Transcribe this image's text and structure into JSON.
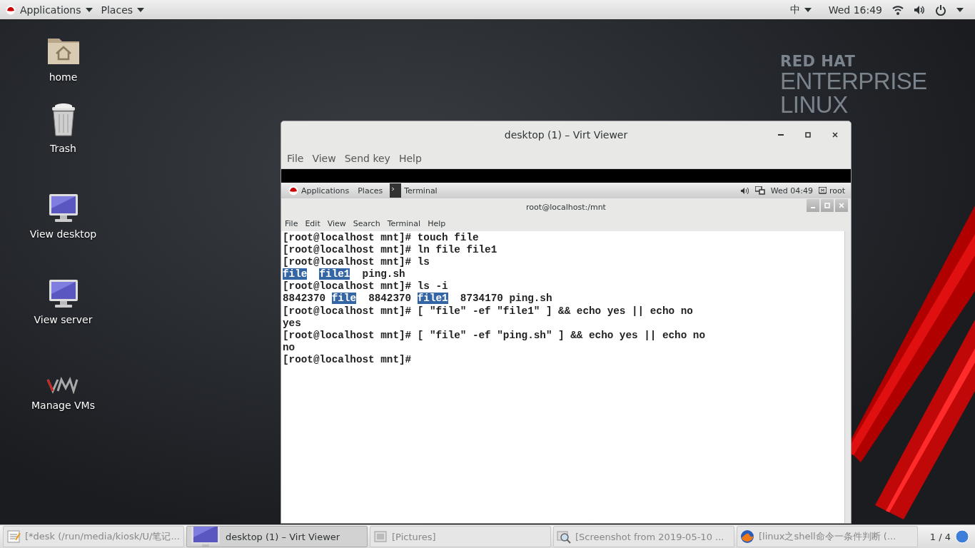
{
  "top_bar": {
    "menus": [
      "Applications",
      "Places"
    ],
    "input_method": "中",
    "clock": "Wed 16:49"
  },
  "desktop_icons": [
    {
      "label": "home",
      "kind": "home"
    },
    {
      "label": "Trash",
      "kind": "trash"
    },
    {
      "label": "View desktop",
      "kind": "monitor"
    },
    {
      "label": "View server",
      "kind": "monitor"
    },
    {
      "label": "Manage VMs",
      "kind": "vm"
    }
  ],
  "logo": {
    "brand": "RED HAT",
    "product": "ENTERPRISE",
    "suffix": "LINUX"
  },
  "window": {
    "title": "desktop (1) – Virt Viewer",
    "menu": [
      "File",
      "View",
      "Send key",
      "Help"
    ],
    "guest": {
      "top_bar": {
        "menus": [
          "Applications",
          "Places"
        ],
        "task": "Terminal",
        "clock": "Wed 04:49",
        "user": "root"
      },
      "terminal": {
        "title": "root@localhost:/mnt",
        "menu": [
          "File",
          "Edit",
          "View",
          "Search",
          "Terminal",
          "Help"
        ],
        "lines": [
          [
            {
              "text": "[root@localhost mnt]# touch file",
              "highlighted": false
            }
          ],
          [
            {
              "text": "[root@localhost mnt]# ln file file1",
              "highlighted": false
            }
          ],
          [
            {
              "text": "[root@localhost mnt]# ls",
              "highlighted": false
            }
          ],
          [
            {
              "text": "file",
              "highlighted": true
            },
            {
              "text": "file1",
              "highlighted": true
            },
            {
              "text": "  ping.sh",
              "highlighted": false
            }
          ],
          [
            {
              "text": "[root@localhost mnt]# ls -i",
              "highlighted": false
            }
          ],
          [
            {
              "text": "8842370",
              "highlighted": false
            },
            {
              "text": "file",
              "highlighted": true
            },
            {
              "text": "  8842370",
              "highlighted": false
            },
            {
              "text": "file1",
              "highlighted": true
            },
            {
              "text": "  8734170 ping.sh",
              "highlighted": false
            }
          ],
          [
            {
              "text": "[root@localhost mnt]# [ \"file\" -ef \"file1\" ] && echo yes || echo no",
              "highlighted": false
            }
          ],
          [
            {
              "text": "yes",
              "highlighted": false
            }
          ],
          [
            {
              "text": "[root@localhost mnt]# [ \"file\" -ef \"ping.sh\" ] && echo yes || echo no",
              "highlighted": false
            }
          ],
          [
            {
              "text": "no",
              "highlighted": false
            }
          ],
          [
            {
              "text": "[root@localhost mnt]#",
              "highlighted": false
            }
          ]
        ]
      }
    }
  },
  "taskbar": {
    "items": [
      {
        "label": "[*desk (/run/media/kiosk/U/笔记...",
        "kind": "editor",
        "selected": false
      },
      {
        "label": "desktop (1) – Virt Viewer",
        "kind": "monitor",
        "selected": true
      },
      {
        "label": "[Pictures]",
        "kind": "folder",
        "selected": false
      },
      {
        "label": "[Screenshot from 2019-05-10 ...",
        "kind": "image",
        "selected": false
      },
      {
        "label": "[linux之shell命令一条件判断 (...",
        "kind": "browser",
        "selected": false
      }
    ],
    "workspace": "1 / 4"
  }
}
